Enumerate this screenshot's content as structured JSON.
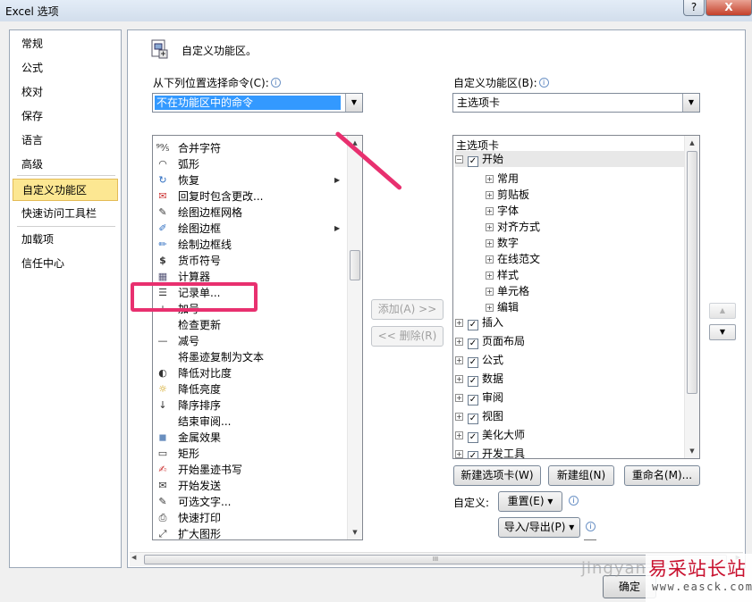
{
  "window": {
    "title": "Excel 选项",
    "help_label": "?",
    "close_label": "X"
  },
  "nav": {
    "items": [
      {
        "label": "常规"
      },
      {
        "label": "公式"
      },
      {
        "label": "校对"
      },
      {
        "label": "保存"
      },
      {
        "label": "语言"
      },
      {
        "label": "高级"
      },
      {
        "label": "自定义功能区",
        "selected": true
      },
      {
        "label": "快速访问工具栏"
      },
      {
        "label": "加载项"
      },
      {
        "label": "信任中心"
      }
    ]
  },
  "main": {
    "section_title": "自定义功能区。",
    "source_label": "从下列位置选择命令(C):",
    "source_value": "不在功能区中的命令",
    "target_label": "自定义功能区(B):",
    "target_value": "主选项卡",
    "commands": [
      {
        "label": "合并字符",
        "icon": "merge-chars-icon",
        "glyph": "⁹⁹⁄₅"
      },
      {
        "label": "弧形",
        "icon": "arc-icon",
        "glyph": "◠"
      },
      {
        "label": "恢复",
        "icon": "redo-icon",
        "glyph": "↻",
        "submenu": true
      },
      {
        "label": "回复时包含更改...",
        "icon": "reply-changes-icon",
        "glyph": "✉"
      },
      {
        "label": "绘图边框网格",
        "icon": "draw-border-grid-icon",
        "glyph": "✎"
      },
      {
        "label": "绘图边框",
        "icon": "draw-border-icon",
        "glyph": "✐",
        "submenu": true
      },
      {
        "label": "绘制边框线",
        "icon": "draw-border-line-icon",
        "glyph": "✏"
      },
      {
        "label": "货币符号",
        "icon": "currency-icon",
        "glyph": "$"
      },
      {
        "label": "计算器",
        "icon": "calculator-icon",
        "glyph": "▦"
      },
      {
        "label": "记录单...",
        "icon": "form-icon",
        "glyph": "☰"
      },
      {
        "label": "加号",
        "icon": "plus-icon",
        "glyph": "+"
      },
      {
        "label": "检查更新",
        "icon": "check-update-icon",
        "glyph": ""
      },
      {
        "label": "减号",
        "icon": "minus-icon",
        "glyph": "—"
      },
      {
        "label": "将墨迹复制为文本",
        "icon": "ink-to-text-icon",
        "glyph": ""
      },
      {
        "label": "降低对比度",
        "icon": "decrease-contrast-icon",
        "glyph": "◐"
      },
      {
        "label": "降低亮度",
        "icon": "decrease-brightness-icon",
        "glyph": "☼"
      },
      {
        "label": "降序排序",
        "icon": "sort-desc-icon",
        "glyph": "↓"
      },
      {
        "label": "结束审阅...",
        "icon": "end-review-icon",
        "glyph": ""
      },
      {
        "label": "金属效果",
        "icon": "metal-effect-icon",
        "glyph": "◼"
      },
      {
        "label": "矩形",
        "icon": "rectangle-icon",
        "glyph": "▭"
      },
      {
        "label": "开始墨迹书写",
        "icon": "ink-start-icon",
        "glyph": "✍"
      },
      {
        "label": "开始发送",
        "icon": "start-send-icon",
        "glyph": "✉"
      },
      {
        "label": "可选文字...",
        "icon": "alt-text-icon",
        "glyph": "✎"
      },
      {
        "label": "快速打印",
        "icon": "quick-print-icon",
        "glyph": "⎙"
      },
      {
        "label": "扩大图形",
        "icon": "enlarge-shape-icon",
        "glyph": "⤢"
      }
    ],
    "add_button": "添加(A) >>",
    "remove_button": "<< 删除(R)",
    "tree": {
      "header": "主选项卡",
      "root": {
        "label": "开始",
        "checked": true,
        "expanded": true
      },
      "groups": [
        "常用",
        "剪贴板",
        "字体",
        "对齐方式",
        "数字",
        "在线范文",
        "样式",
        "单元格",
        "编辑"
      ],
      "tabs": [
        {
          "label": "插入",
          "checked": true
        },
        {
          "label": "页面布局",
          "checked": true
        },
        {
          "label": "公式",
          "checked": true
        },
        {
          "label": "数据",
          "checked": true
        },
        {
          "label": "审阅",
          "checked": true
        },
        {
          "label": "视图",
          "checked": true
        },
        {
          "label": "美化大师",
          "checked": true
        },
        {
          "label": "开发工具",
          "checked": true
        }
      ]
    },
    "new_tab_button": "新建选项卡(W)",
    "new_group_button": "新建组(N)",
    "rename_button": "重命名(M)...",
    "customize_label": "自定义:",
    "reset_button": "重置(E) ▾",
    "import_export_button": "导入/导出(P) ▾",
    "scroll_grip": "III"
  },
  "footer": {
    "ok_button": "确定"
  },
  "watermark": {
    "faint": "jingyan",
    "site_cn": "易采站长站",
    "site_url": "www.easck.com"
  }
}
